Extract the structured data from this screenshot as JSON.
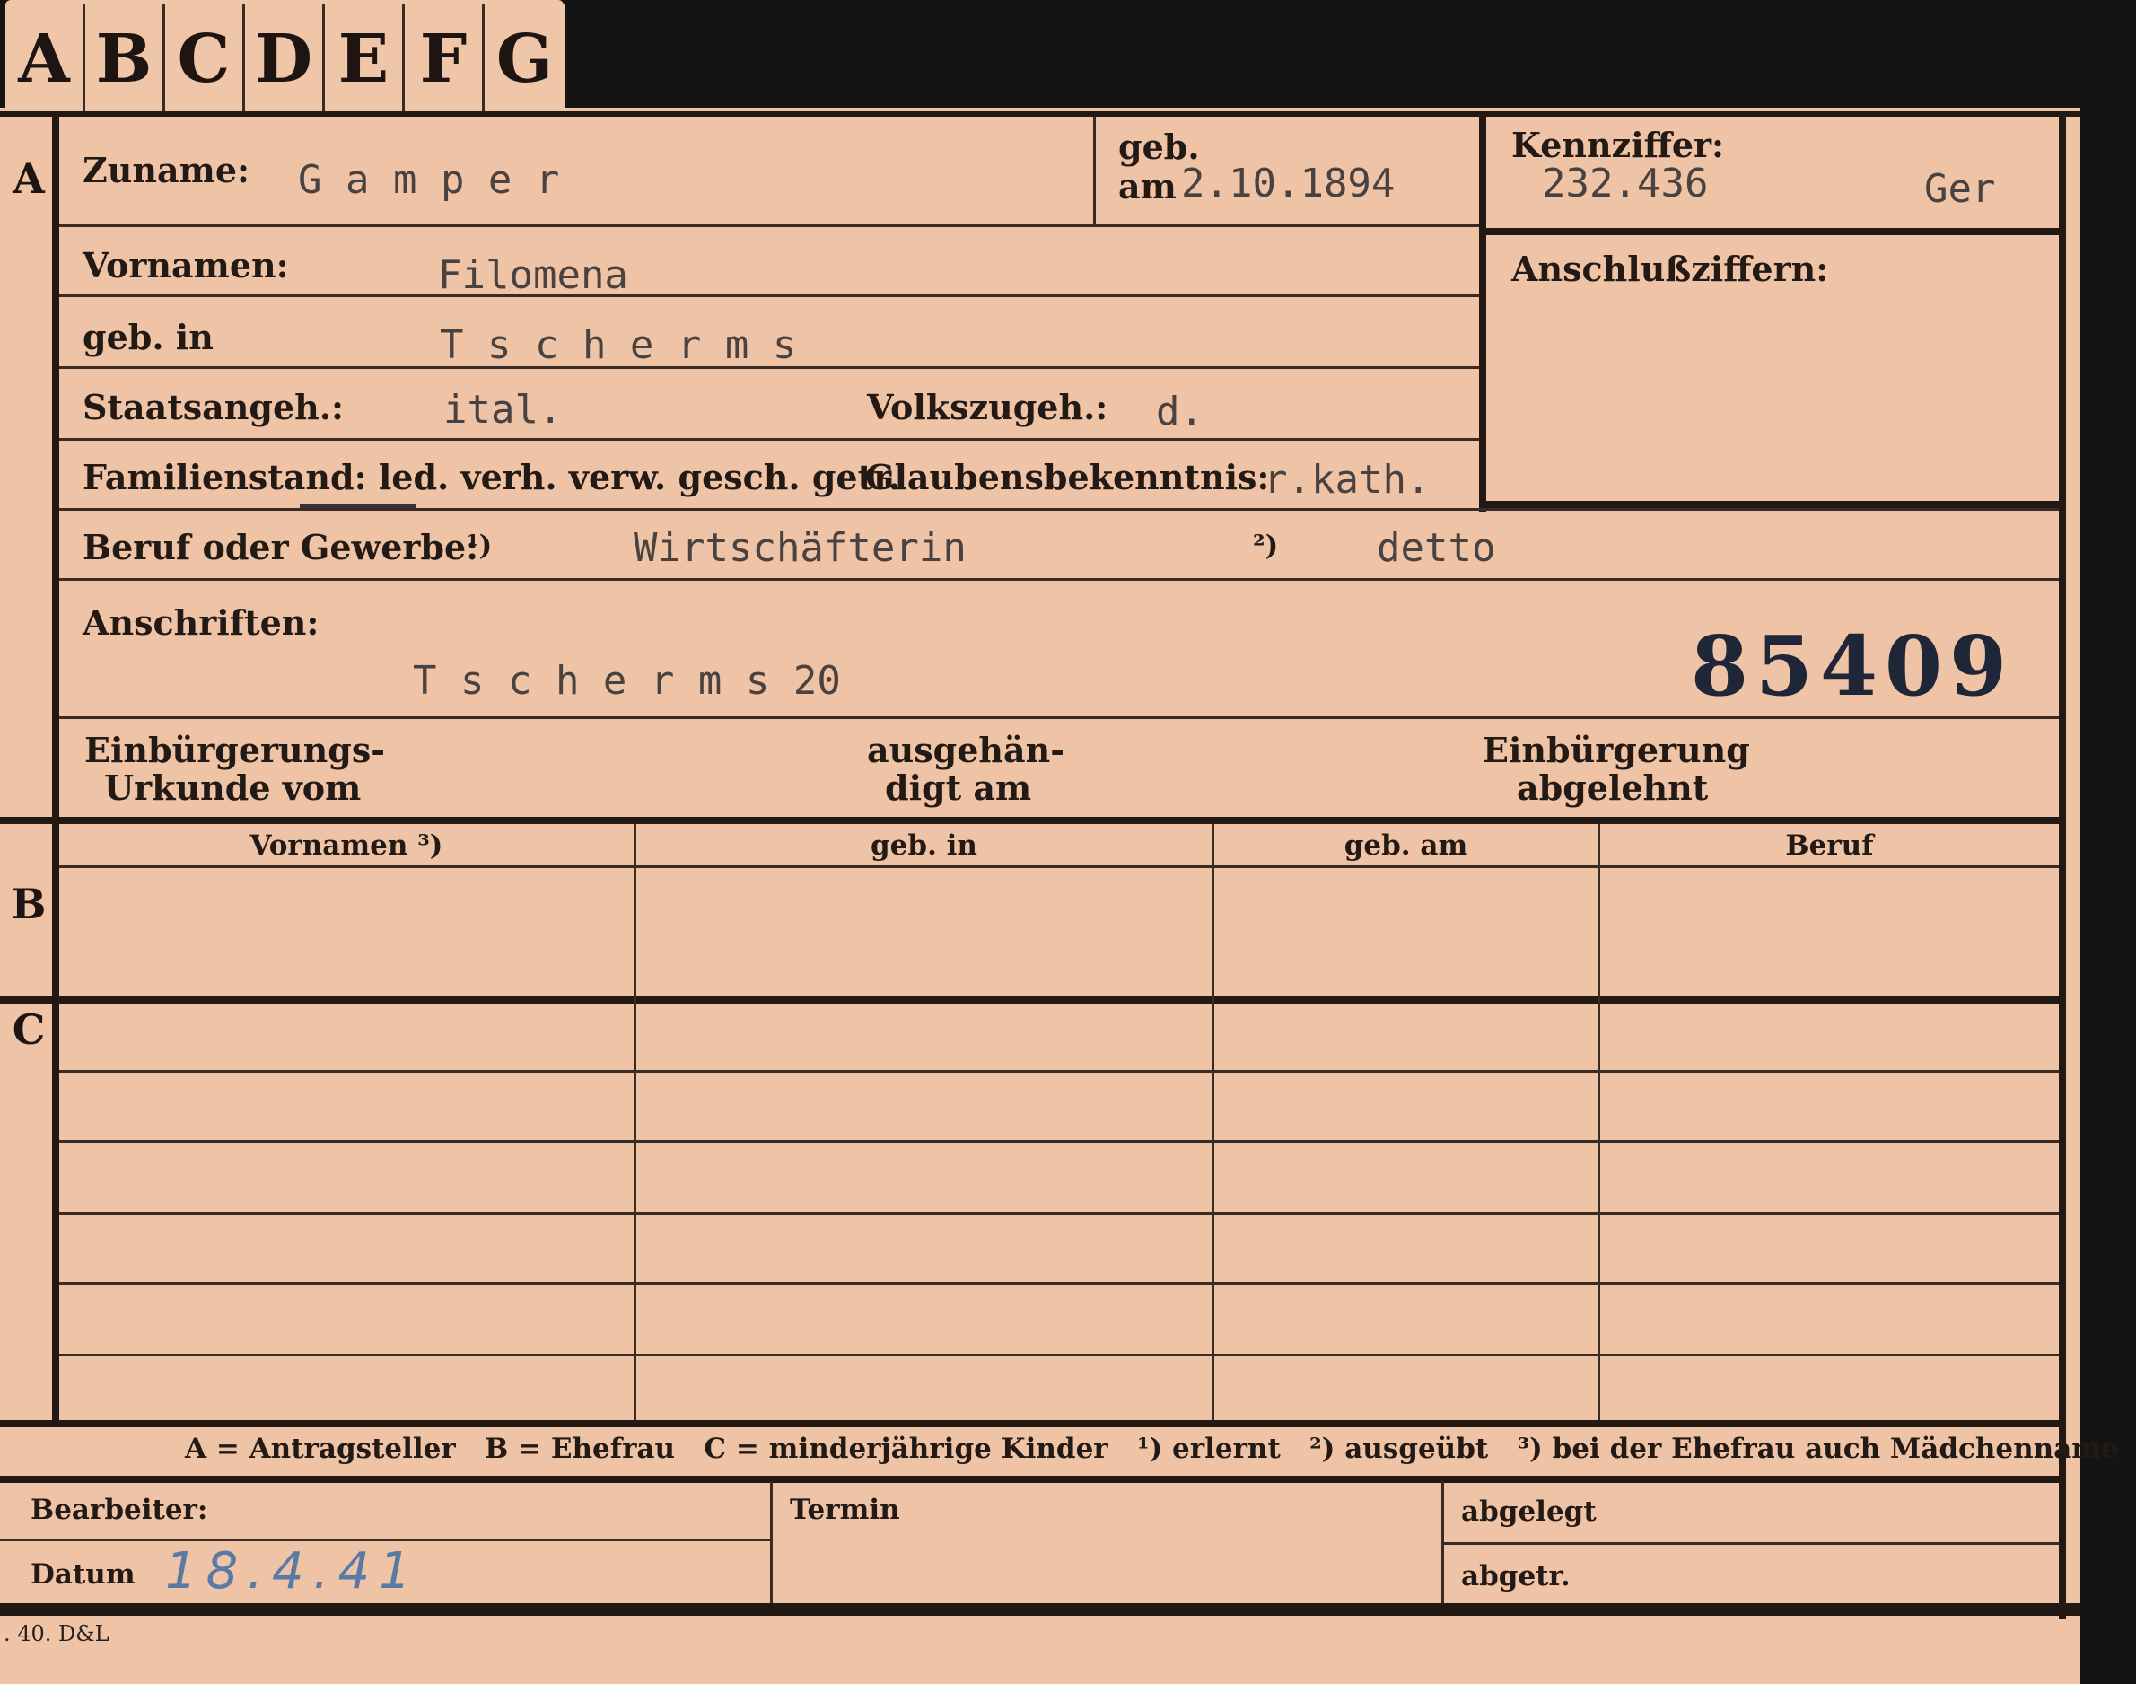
{
  "tabs": [
    "A",
    "B",
    "C",
    "D",
    "E",
    "F",
    "G"
  ],
  "section_letters": {
    "a": "A",
    "b": "B",
    "c": "C"
  },
  "fields": {
    "zuname_label": "Zuname:",
    "zuname_value": "G a m p e r",
    "geb_label": "geb.",
    "geb_am_label": "am",
    "geb_am_value": "2.10.1894",
    "kennziffer_label": "Kennziffer:",
    "kennziffer_value": "232.436",
    "kennziffer_suffix": "Ger",
    "anschluss_label": "Anschlußziffern:",
    "vornamen_label": "Vornamen:",
    "vornamen_value": "Filomena",
    "gebin_label": "geb. in",
    "gebin_value": "T s c h e r m s",
    "staats_label": "Staatsangeh.:",
    "staats_value": "ital.",
    "volks_label": "Volkszugeh.:",
    "volks_value": "d.",
    "familien_label": "Familienstand: led. verh. verw. gesch. getr.",
    "glauben_label": "Glaubensbekenntnis:",
    "glauben_value": "r.kath.",
    "beruf_label": "Beruf oder Gewerbe:",
    "beruf_mark1": "¹)",
    "beruf_value1": "Wirtschäfterin",
    "beruf_mark2": "²)",
    "beruf_value2": "detto",
    "anschriften_label": "Anschriften:",
    "anschriften_value": "T s c h e r m s 20",
    "stamp_number": "85409",
    "einb_urkunde_1": "Einbürgerungs-",
    "einb_urkunde_2": "Urkunde vom",
    "ausgeh_1": "ausgehän-",
    "ausgeh_2": "digt am",
    "einb_abgel_1": "Einbürgerung",
    "einb_abgel_2": "abgelehnt"
  },
  "table_headers": [
    "Vornamen ³)",
    "geb. in",
    "geb. am",
    "Beruf"
  ],
  "legend": "A = Antragsteller   B = Ehefrau   C = minderjährige Kinder   ¹) erlernt   ²) ausgeübt   ³) bei der Ehefrau auch Mädchenname",
  "footer": {
    "bearbeiter_label": "Bearbeiter:",
    "datum_label": "Datum",
    "datum_value": "18.4.41",
    "termin_label": "Termin",
    "abgelegt_label": "abgelegt",
    "abgetr_label": "abgetr.",
    "print_code": ". 40. D&L"
  }
}
